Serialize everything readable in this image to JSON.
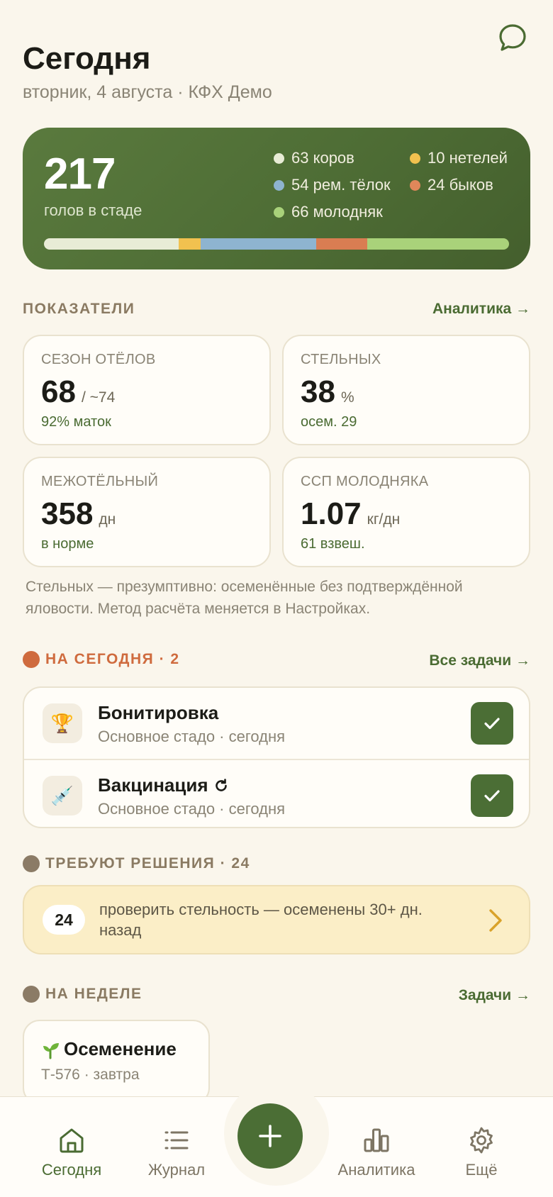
{
  "header": {
    "title": "Сегодня",
    "subtitle": "вторник, 4 августа · КФХ Демо",
    "chat_icon": "chat-bubble-icon"
  },
  "herd": {
    "total": "217",
    "caption": "голов в стаде",
    "legend": [
      {
        "label": "63 коров",
        "color": "#e8ecd6"
      },
      {
        "label": "10 нетелей",
        "color": "#f1c14f"
      },
      {
        "label": "54 рем. тёлок",
        "color": "#8eb4d0"
      },
      {
        "label": "24 быков",
        "color": "#e0875a"
      },
      {
        "label": "66 молодняк",
        "color": "#a9d27a"
      }
    ],
    "bar_segments": [
      {
        "name": "коровы",
        "value": 63,
        "color": "#e8ecd6"
      },
      {
        "name": "нетели",
        "value": 10,
        "color": "#f1c14f"
      },
      {
        "name": "рем. тёлки",
        "value": 54,
        "color": "#8eb4d0"
      },
      {
        "name": "быки",
        "value": 24,
        "color": "#d97d52"
      },
      {
        "name": "молодняк",
        "value": 66,
        "color": "#a9d27a"
      }
    ]
  },
  "indicators": {
    "heading": "ПОКАЗАТЕЛИ",
    "link": "Аналитика →",
    "cards": [
      {
        "label": "СЕЗОН ОТЁЛОВ",
        "value": "68",
        "unit": "/ ~74",
        "sub": "92% маток"
      },
      {
        "label": "СТЕЛЬНЫХ",
        "value": "38",
        "unit": "%",
        "sub": "осем. 29"
      },
      {
        "label": "МЕЖОТЁЛЬНЫЙ",
        "value": "358",
        "unit": "дн",
        "sub": "в норме"
      },
      {
        "label": "ССП МОЛОДНЯКА",
        "value": "1.07",
        "unit": "кг/дн",
        "sub": "61 взвеш."
      }
    ],
    "note": "Стельных — презумптивно: осеменённые без подтверждённой яловости. Метод расчёта меняется в Настройках."
  },
  "today": {
    "heading": "НА СЕГОДНЯ · 2",
    "link": "Все задачи →",
    "dot_color": "#cf6b3e",
    "tasks": [
      {
        "title": "Бонитировка",
        "sub": "Основное стадо · сегодня",
        "icon": "trophy-icon",
        "glyph": "🏆"
      },
      {
        "title": "Вакцинация",
        "sub": "Основное стадо · сегодня",
        "icon": "syringe-icon",
        "glyph": "💉",
        "recurring_icon": "repeat-icon"
      }
    ]
  },
  "decisions": {
    "heading": "ТРЕБУЮТ РЕШЕНИЯ · 24",
    "dot_color": "#8b7b66",
    "item": {
      "count": "24",
      "text": "проверить стельность — осеменены 30+ дн. назад"
    }
  },
  "week": {
    "heading": "НА НЕДЕЛЕ",
    "link": "Задачи →",
    "dot_color": "#8b7b66",
    "card": {
      "title": "Осеменение",
      "sub": "Т-576 · завтра",
      "icon": "sprout-icon"
    }
  },
  "nav": {
    "items": [
      {
        "label": "Сегодня",
        "icon": "home-icon",
        "active": true
      },
      {
        "label": "Журнал",
        "icon": "list-icon",
        "active": false
      },
      {
        "label": "Аналитика",
        "icon": "bar-chart-icon",
        "active": false
      },
      {
        "label": "Ещё",
        "icon": "gear-icon",
        "active": false
      }
    ],
    "fab_icon": "plus-icon"
  }
}
